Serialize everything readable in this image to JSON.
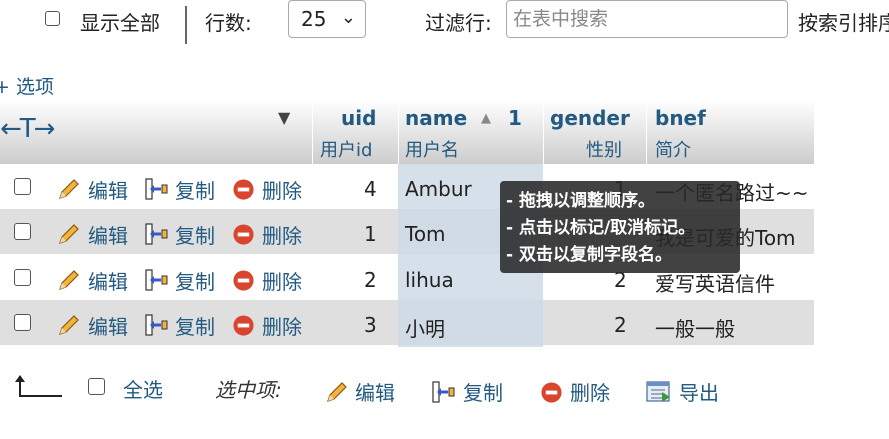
{
  "controls": {
    "show_all_label": "显示全部",
    "rows_label": "行数:",
    "rows_value": "25",
    "filter_label": "过滤行:",
    "filter_placeholder": "在表中搜索",
    "sort_label": "按索引排序"
  },
  "options_link": "+ 选项",
  "table": {
    "columns": [
      {
        "name": "uid",
        "comment": "用户id"
      },
      {
        "name": "name",
        "comment": "用户名",
        "sort_order": "1"
      },
      {
        "name": "gender",
        "comment": "性别"
      },
      {
        "name": "bnef",
        "comment": "简介"
      }
    ],
    "actions": {
      "edit": "编辑",
      "copy": "复制",
      "delete": "删除"
    },
    "rows": [
      {
        "uid": "4",
        "name": "Ambur",
        "gender": "1",
        "bnef": "一个匿名路过~~"
      },
      {
        "uid": "1",
        "name": "Tom",
        "gender": "",
        "bnef": "我是可爱的Tom"
      },
      {
        "uid": "2",
        "name": "lihua",
        "gender": "2",
        "bnef": "爱写英语信件"
      },
      {
        "uid": "3",
        "name": "小明",
        "gender": "2",
        "bnef": "一般一般"
      }
    ]
  },
  "tooltip": {
    "lines": [
      "- 拖拽以调整顺序。",
      "- 点击以标记/取消标记。",
      "- 双击以复制字段名。"
    ]
  },
  "footer": {
    "select_all": "全选",
    "with_selected": "选中项:",
    "edit": "编辑",
    "copy": "复制",
    "delete": "删除",
    "export": "导出"
  },
  "colors": {
    "link": "#235a81",
    "row_alt": "#dfdfdf",
    "tooltip_bg": "#282828",
    "delete_icon": "#d9452e"
  }
}
